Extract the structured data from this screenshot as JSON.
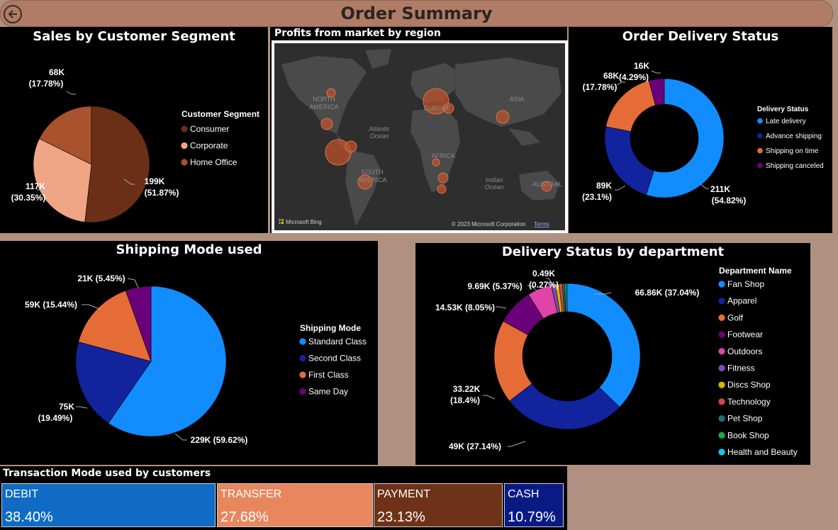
{
  "header": {
    "title": "Order Summary"
  },
  "colors": {
    "header_bg": "#b07c66",
    "page_bg": "#b09080",
    "panel_bg": "#000000"
  },
  "segment": {
    "title": "Sales by Customer Segment",
    "legend_title": "Customer Segment",
    "labels": [
      {
        "value": "199K",
        "pct": "(51.87%)"
      },
      {
        "value": "117K",
        "pct": "(30.35%)"
      },
      {
        "value": "68K",
        "pct": "(17.78%)"
      }
    ]
  },
  "map": {
    "title": "Profits from market by region",
    "labels": [
      "NORTH",
      "AMERICA",
      "SOUTH",
      "AMERICA",
      "AFRICA",
      "ASIA",
      "AUSTRAL",
      "Atlantic",
      "Ocean",
      "Indian",
      "Ocean",
      "EUROPE"
    ],
    "bing": "Microsoft Bing",
    "copyright": "© 2023 Microsoft Corporation",
    "terms": "Terms"
  },
  "delivery": {
    "title": "Order Delivery Status",
    "legend_title": "Delivery Status",
    "labels": [
      {
        "value": "211K",
        "pct": "(54.82%)"
      },
      {
        "value": "89K",
        "pct": "(23.1%)"
      },
      {
        "value": "68K",
        "pct": "(17.78%)"
      },
      {
        "value": "16K",
        "pct": "(4.29%)"
      }
    ]
  },
  "shipping": {
    "title": "Shipping Mode used",
    "legend_title": "Shipping Mode",
    "labels": [
      "229K (59.62%)",
      "75K",
      "(19.49%)",
      "59K (15.44%)",
      "21K (5.45%)"
    ]
  },
  "department": {
    "title": "Delivery Status by department",
    "legend_title": "Department Name",
    "labels": [
      "66.86K (37.04%)",
      "49K (27.14%)",
      "33.22K",
      "(18.4%)",
      "14.53K (8.05%)",
      "9.69K (5.37%)",
      "0.49K",
      "(0.27%)"
    ]
  },
  "transactions": {
    "title": "Transaction Mode used by customers",
    "cards": [
      {
        "label": "DEBIT",
        "value": "38.40%",
        "color": "#0f6bc4"
      },
      {
        "label": "TRANSFER",
        "value": "27.68%",
        "color": "#e8875e"
      },
      {
        "label": "PAYMENT",
        "value": "23.13%",
        "color": "#6e3219"
      },
      {
        "label": "CASH",
        "value": "10.79%",
        "color": "#0a1a85"
      }
    ]
  },
  "chart_data": [
    {
      "type": "pie",
      "title": "Sales by Customer Segment",
      "legend_title": "Customer Segment",
      "categories": [
        "Consumer",
        "Corporate",
        "Home Office"
      ],
      "values": [
        199,
        117,
        68
      ],
      "percentages": [
        51.87,
        30.35,
        17.78
      ],
      "colors": [
        "#6b2f18",
        "#f0a585",
        "#a9532e"
      ],
      "legend_position": "right"
    },
    {
      "type": "donut",
      "title": "Order Delivery Status",
      "legend_title": "Delivery Status",
      "categories": [
        "Late delivery",
        "Advance shipping",
        "Shipping on time",
        "Shipping canceled"
      ],
      "values": [
        211,
        89,
        68,
        16
      ],
      "percentages": [
        54.82,
        23.1,
        17.78,
        4.29
      ],
      "colors": [
        "#118dff",
        "#12239e",
        "#e66c37",
        "#6b007b"
      ],
      "legend_position": "right"
    },
    {
      "type": "pie",
      "title": "Shipping Mode used",
      "legend_title": "Shipping Mode",
      "categories": [
        "Standard Class",
        "Second Class",
        "First Class",
        "Same Day"
      ],
      "values": [
        229,
        75,
        59,
        21
      ],
      "percentages": [
        59.62,
        19.49,
        15.44,
        5.45
      ],
      "colors": [
        "#118dff",
        "#12239e",
        "#e66c37",
        "#6b007b"
      ],
      "legend_position": "right"
    },
    {
      "type": "donut",
      "title": "Delivery Status by department",
      "legend_title": "Department Name",
      "categories": [
        "Fan Shop",
        "Apparel",
        "Golf",
        "Footwear",
        "Outdoors",
        "Fitness",
        "Discs Shop",
        "Technology",
        "Pet Shop",
        "Book Shop",
        "Health and Beauty"
      ],
      "values": [
        66.86,
        49,
        33.22,
        14.53,
        9.69,
        1.6,
        1.5,
        1.3,
        0.8,
        0.6,
        0.49
      ],
      "percentages": [
        37.04,
        27.14,
        18.4,
        8.05,
        5.37,
        0.89,
        0.83,
        0.72,
        0.44,
        0.33,
        0.27
      ],
      "colors": [
        "#118dff",
        "#12239e",
        "#e66c37",
        "#6b007b",
        "#e044a7",
        "#744ec2",
        "#d9b300",
        "#d64550",
        "#197278",
        "#1aab40",
        "#15c6f4"
      ],
      "legend_position": "right"
    },
    {
      "type": "bubble-map",
      "title": "Profits from market by region",
      "bubble_color": "#c0532a"
    },
    {
      "type": "table",
      "title": "Transaction Mode used by customers",
      "categories": [
        "DEBIT",
        "TRANSFER",
        "PAYMENT",
        "CASH"
      ],
      "values": [
        38.4,
        27.68,
        23.13,
        10.79
      ]
    }
  ]
}
